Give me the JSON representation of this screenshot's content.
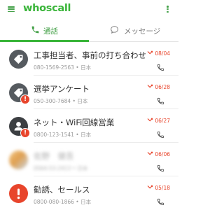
{
  "app": {
    "name": "whoscall"
  },
  "colors": {
    "brand": "#3ab53a",
    "missed": "#e8452c",
    "alert": "#e8452c"
  },
  "icons": {
    "menu": "hamburger-menu-icon",
    "more": "more-vert-icon",
    "calls_tab": "phone-icon",
    "messages_tab": "chat-bubble-icon",
    "missed": "missed-call-icon",
    "call": "phone-icon"
  },
  "tabs": [
    {
      "label": "通話",
      "selected": true
    },
    {
      "label": "メッセージ",
      "selected": false
    }
  ],
  "calls": [
    {
      "name": "工事担当者、事前の打ち合わせ",
      "number": "080-1569-2563",
      "region": "日本",
      "date": "08/04",
      "avatar": "tag"
    },
    {
      "name": "選挙アンケート",
      "number": "050-300-7684",
      "region": "日本",
      "date": "06/28",
      "avatar": "tag-alert"
    },
    {
      "name": "ネット・WiFi回線営業",
      "number": "0800-123-1541",
      "region": "日本",
      "date": "06/27",
      "avatar": "person-alert"
    },
    {
      "name": "佐野　健吾",
      "number": "0564-53-2413",
      "region": "日本",
      "date": "06/06",
      "avatar": "photo"
    },
    {
      "name": "勧誘、セールス",
      "number": "0800-080-1866",
      "region": "日本",
      "date": "05/18",
      "avatar": "alert"
    }
  ]
}
